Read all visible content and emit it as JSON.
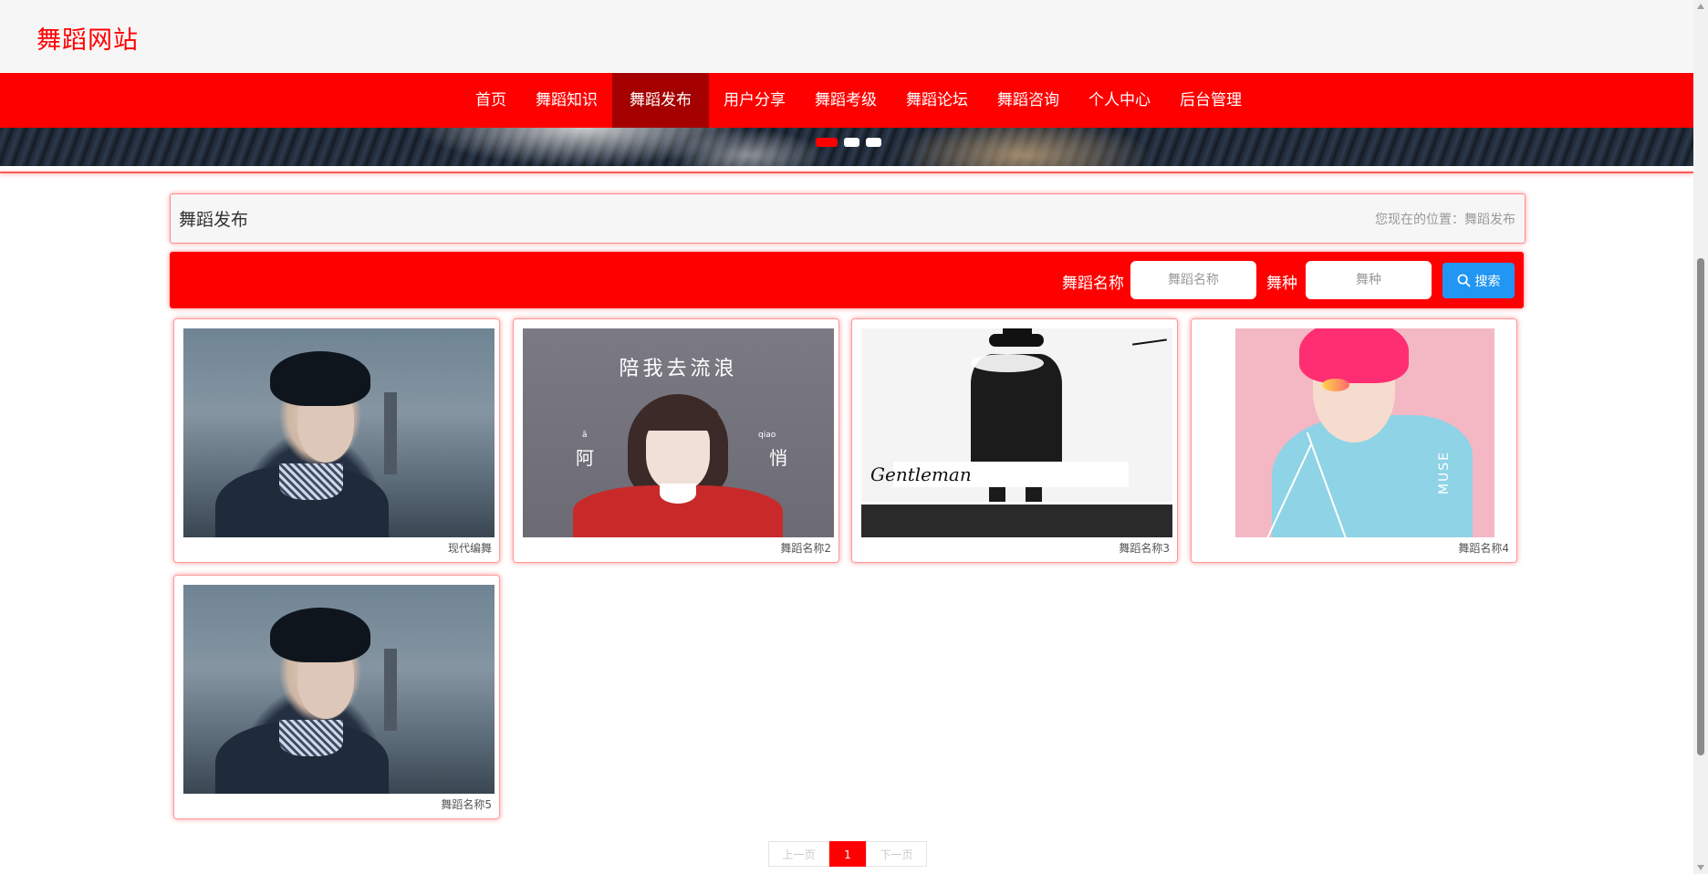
{
  "header": {
    "site_title": "舞蹈网站"
  },
  "nav": {
    "items": [
      "首页",
      "舞蹈知识",
      "舞蹈发布",
      "用户分享",
      "舞蹈考级",
      "舞蹈论坛",
      "舞蹈咨询",
      "个人中心",
      "后台管理"
    ],
    "active": "舞蹈发布"
  },
  "banner": {
    "slides": 3,
    "active_slide": 1
  },
  "page": {
    "title": "舞蹈发布",
    "breadcrumb": "您现在的位置：舞蹈发布"
  },
  "search": {
    "name_label": "舞蹈名称",
    "name_placeholder": "舞蹈名称",
    "type_label": "舞种",
    "type_placeholder": "舞种",
    "button_label": "搜索",
    "button_icon": "search-icon"
  },
  "cards": [
    {
      "caption": "现代编舞"
    },
    {
      "caption": "舞蹈名称2",
      "art_title": "陪我去流浪",
      "art_left": "阿",
      "art_right": "悄",
      "art_left_pinyin": "ā",
      "art_right_pinyin": "qiao"
    },
    {
      "caption": "舞蹈名称3",
      "art_signature": "Gentleman"
    },
    {
      "caption": "舞蹈名称4",
      "art_text": "MUSE"
    },
    {
      "caption": "舞蹈名称5"
    }
  ],
  "pagination": {
    "prev": "上一页",
    "current": "1",
    "next": "下一页"
  },
  "colors": {
    "primary": "#ff0000",
    "active_nav": "#a50000",
    "search_button": "#2196f3"
  }
}
